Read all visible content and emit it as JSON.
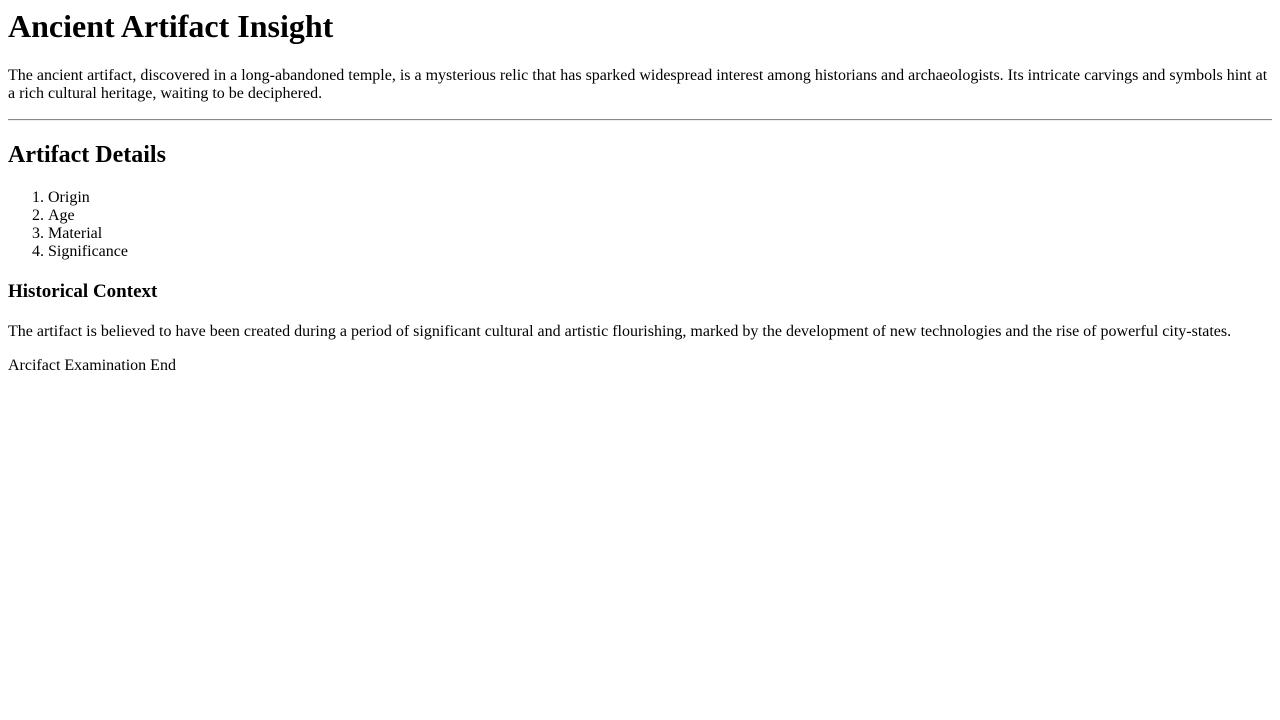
{
  "header": {
    "title": "Ancient Artifact Insight"
  },
  "intro": {
    "text": "The ancient artifact, discovered in a long-abandoned temple, is a mysterious relic that has sparked widespread interest among historians and archaeologists. Its intricate carvings and symbols hint at a rich cultural heritage, waiting to be deciphered."
  },
  "details": {
    "heading": "Artifact Details",
    "items": [
      {
        "label": "Origin"
      },
      {
        "label": "Age"
      },
      {
        "label": "Material"
      },
      {
        "label": "Significance"
      }
    ]
  },
  "context": {
    "heading": "Historical Context",
    "text": "The artifact is believed to have been created during a period of significant cultural and artistic flourishing, marked by the development of new technologies and the rise of powerful city-states."
  },
  "footer": {
    "text": "Arcifact Examination End"
  }
}
